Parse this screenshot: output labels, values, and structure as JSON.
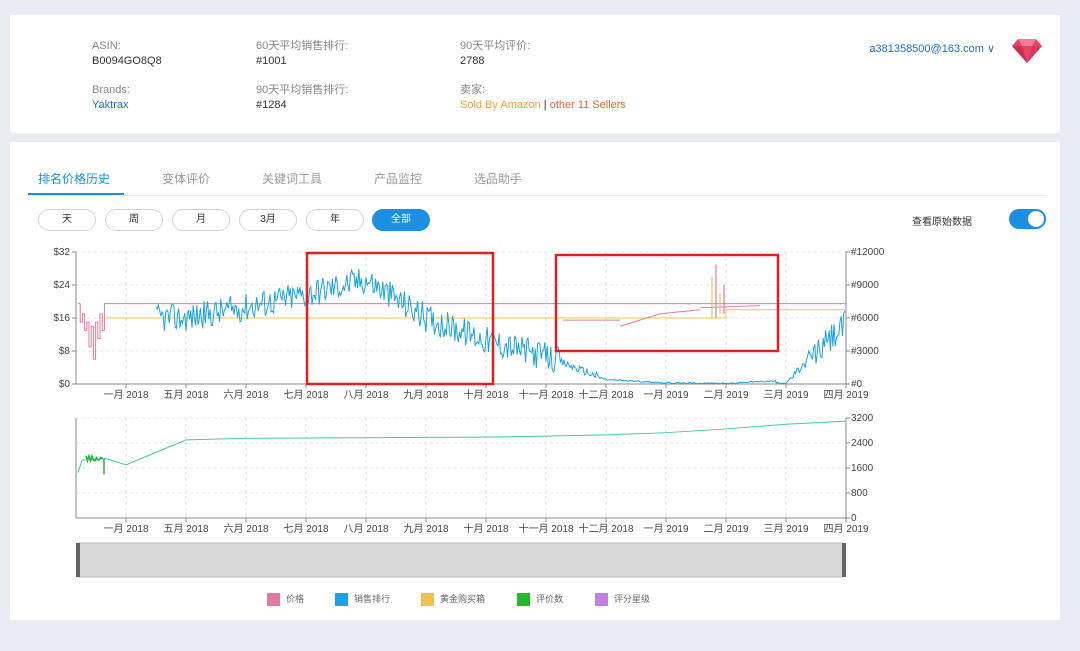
{
  "header": {
    "asin_label": "ASIN:",
    "asin_value": "B0094GO8Q8",
    "brands_label": "Brands:",
    "brands_value": "Yaktrax",
    "rank60_label": "60天平均销售排行:",
    "rank60_value": "#1001",
    "rank90_label": "90天平均销售排行:",
    "rank90_value": "#1284",
    "reviews90_label": "90天平均评价:",
    "reviews90_value": "2788",
    "seller_label": "卖家:",
    "seller_amazon": "Sold By Amazon",
    "seller_sep": "|",
    "seller_other": "other 11 Sellers",
    "user_email": "a381358500@163.com ∨"
  },
  "tabs": [
    "排名价格历史",
    "变体评价",
    "关键词工具",
    "产品监控",
    "选品助手"
  ],
  "range_buttons": [
    "天",
    "周",
    "月",
    "3月",
    "年",
    "全部"
  ],
  "active_range": "全部",
  "toggle_label": "查看原始数据",
  "legend": [
    "价格",
    "销售排行",
    "黄金购买箱",
    "评价数",
    "评分星级"
  ],
  "colors": {
    "price": "#e07aa0",
    "rank": "#1aa3e0",
    "buybox": "#f0c050",
    "reviews": "#22b830",
    "rating": "#c080e0",
    "review_line": "#40c8b0",
    "highlight": "#e02020",
    "accent": "#1d8fe1"
  },
  "chart_data": [
    {
      "type": "line",
      "name": "price-rank-chart",
      "x_ticks": [
        "一月 2018",
        "五月 2018",
        "六月 2018",
        "七月 2018",
        "八月 2018",
        "九月 2018",
        "十月 2018",
        "十一月 2018",
        "十二月 2018",
        "一月 2019",
        "二月 2019",
        "三月 2019",
        "四月 2019"
      ],
      "y_left_ticks": [
        "$0",
        "$8",
        "$16",
        "$24",
        "$32"
      ],
      "y_left_range": [
        0,
        32
      ],
      "y_right_ticks": [
        "#0",
        "#3000",
        "#6000",
        "#9000",
        "#12000"
      ],
      "y_right_range": [
        0,
        12000
      ],
      "series": [
        {
          "name": "价格",
          "values": [
            19.5,
            15,
            17,
            6,
            14,
            19.5,
            19.5,
            19.5,
            19.5,
            19.5,
            19.5,
            19.5,
            19.5
          ]
        },
        {
          "name": "销售排行",
          "values": [
            null,
            6000,
            7000,
            8200,
            9500,
            6000,
            4000,
            2500,
            400,
            100,
            50,
            100,
            5500
          ]
        },
        {
          "name": "黄金购买箱",
          "values": [
            null,
            null,
            16,
            16,
            16,
            16,
            16,
            16,
            16,
            16,
            18,
            18,
            18
          ]
        }
      ]
    },
    {
      "type": "line",
      "name": "review-chart",
      "x_ticks": [
        "一月 2018",
        "五月 2018",
        "六月 2018",
        "七月 2018",
        "八月 2018",
        "九月 2018",
        "十月 2018",
        "十一月 2018",
        "十二月 2018",
        "一月 2019",
        "二月 2019",
        "三月 2019",
        "四月 2019"
      ],
      "y_right_ticks": [
        "0",
        "800",
        "1600",
        "2400",
        "3200"
      ],
      "y_right_range": [
        0,
        3200
      ],
      "series": [
        {
          "name": "评价数",
          "values": [
            1700,
            2500,
            2550,
            2560,
            2570,
            2580,
            2590,
            2620,
            2660,
            2730,
            2850,
            3000,
            3100
          ]
        }
      ]
    }
  ]
}
